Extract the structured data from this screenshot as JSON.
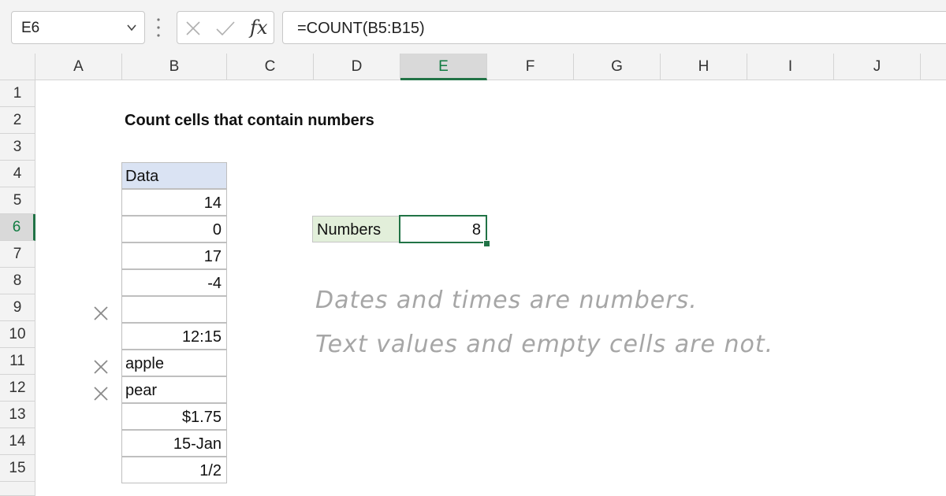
{
  "formula_bar": {
    "name_box": "E6",
    "fx_label": "fx",
    "formula": "=COUNT(B5:B15)"
  },
  "columns": [
    "A",
    "B",
    "C",
    "D",
    "E",
    "F",
    "G",
    "H",
    "I",
    "J"
  ],
  "rows": [
    "1",
    "2",
    "3",
    "4",
    "5",
    "6",
    "7",
    "8",
    "9",
    "10",
    "11",
    "12",
    "13",
    "14",
    "15"
  ],
  "sheet": {
    "title": "Count cells that contain numbers",
    "data_header": "Data",
    "data_values": [
      "14",
      "0",
      "17",
      "-4",
      "",
      "12:15",
      "apple",
      "pear",
      "$1.75",
      "15-Jan",
      "1/2"
    ],
    "result_label": "Numbers",
    "result_value": "8"
  },
  "notes": {
    "line1": "Dates and times are numbers.",
    "line2": "Text values and empty cells are not."
  },
  "colors": {
    "accent": "#217346",
    "header_fill": "#dae3f3",
    "label_fill": "#e2efda",
    "note_text": "#a6a6a6"
  }
}
